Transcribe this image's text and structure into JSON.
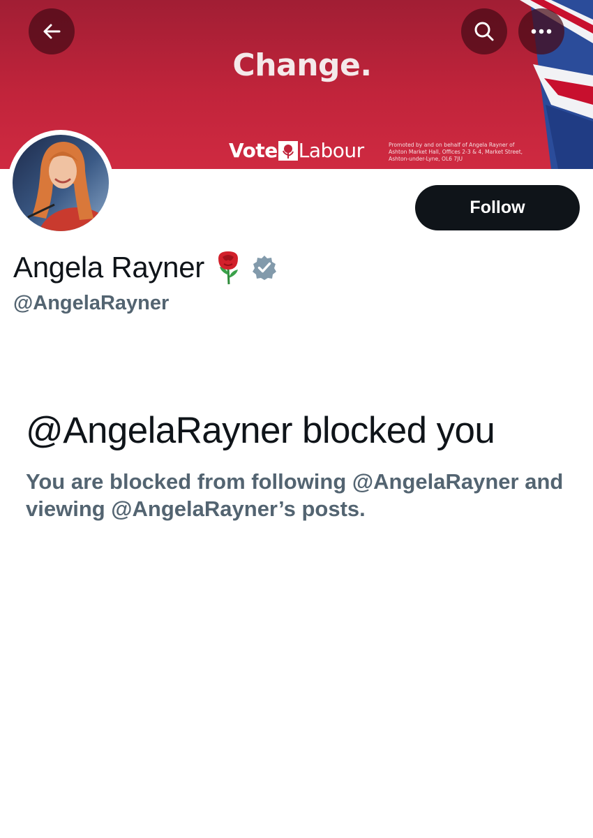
{
  "banner": {
    "headline": "Change.",
    "vote_label": "Vote",
    "party_label": "Labour",
    "imprint": "Promoted by and on behalf of Angela Rayner of Ashton Market Hall, Offices 2-3 & 4, Market Street, Ashton-under-Lyne, OL6 7JU",
    "colors": {
      "banner_red": "#c1243b",
      "flag_blue": "#2b4c9a",
      "flag_white": "#f2f2f5"
    }
  },
  "nav": {
    "back_icon": "arrow-left-icon",
    "search_icon": "search-icon",
    "more_icon": "more-horizontal-icon"
  },
  "profile": {
    "display_name": "Angela Rayner",
    "name_emoji": "rose-emoji",
    "verified_icon": "verified-badge-icon",
    "handle": "@AngelaRayner",
    "follow_label": "Follow"
  },
  "blocked": {
    "title": "@AngelaRayner blocked you",
    "description": "You are blocked from following @AngelaRayner and viewing @AngelaRayner’s posts."
  },
  "colors": {
    "text_primary": "#0f1419",
    "text_secondary": "#536471",
    "button_dark": "#0f1419",
    "verified_grey": "#829aab"
  }
}
